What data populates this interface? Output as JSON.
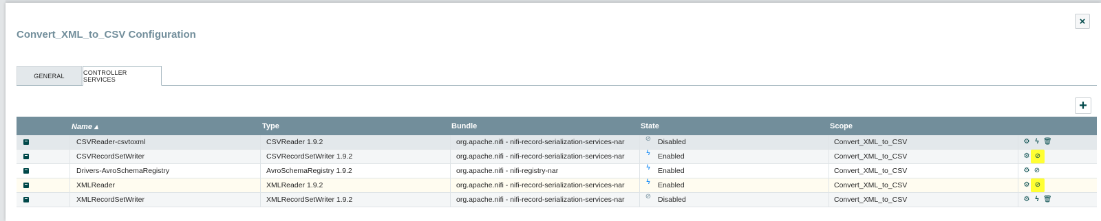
{
  "dialog": {
    "title": "Convert_XML_to_CSV Configuration",
    "close_icon": "×"
  },
  "tabs": [
    {
      "label": "GENERAL"
    },
    {
      "label": "CONTROLLER SERVICES"
    }
  ],
  "add_icon": "+",
  "table": {
    "columns": {
      "name": "Name ▴",
      "type": "Type",
      "bundle": "Bundle",
      "state": "State",
      "scope": "Scope"
    },
    "rows": [
      {
        "name": "CSVReader-csvtoxml",
        "type": "CSVReader 1.9.2",
        "bundle": "org.apache.nifi - nifi-record-serialization-services-nar",
        "state": "Disabled",
        "scope": "Convert_XML_to_CSV"
      },
      {
        "name": "CSVRecordSetWriter",
        "type": "CSVRecordSetWriter 1.9.2",
        "bundle": "org.apache.nifi - nifi-record-serialization-services-nar",
        "state": "Enabled",
        "scope": "Convert_XML_to_CSV"
      },
      {
        "name": "Drivers-AvroSchemaRegistry",
        "type": "AvroSchemaRegistry 1.9.2",
        "bundle": "org.apache.nifi - nifi-registry-nar",
        "state": "Enabled",
        "scope": "Convert_XML_to_CSV"
      },
      {
        "name": "XMLReader",
        "type": "XMLReader 1.9.2",
        "bundle": "org.apache.nifi - nifi-record-serialization-services-nar",
        "state": "Enabled",
        "scope": "Convert_XML_to_CSV"
      },
      {
        "name": "XMLRecordSetWriter",
        "type": "XMLRecordSetWriter 1.9.2",
        "bundle": "org.apache.nifi - nifi-record-serialization-services-nar",
        "state": "Disabled",
        "scope": "Convert_XML_to_CSV"
      }
    ]
  },
  "icons": {
    "enabled_state": "lightning-bolt-icon",
    "disabled_state": "disabled-icon",
    "row_book": "book-icon",
    "configure": "gear-icon",
    "enable": "lightning-bolt-icon",
    "disable": "disable-icon",
    "remove": "trash-icon"
  },
  "colors": {
    "header_bg": "#728e9b",
    "title": "#728e9b",
    "accent": "#004849",
    "enabled": "#1f8ff6",
    "highlight": "#ffff33"
  }
}
